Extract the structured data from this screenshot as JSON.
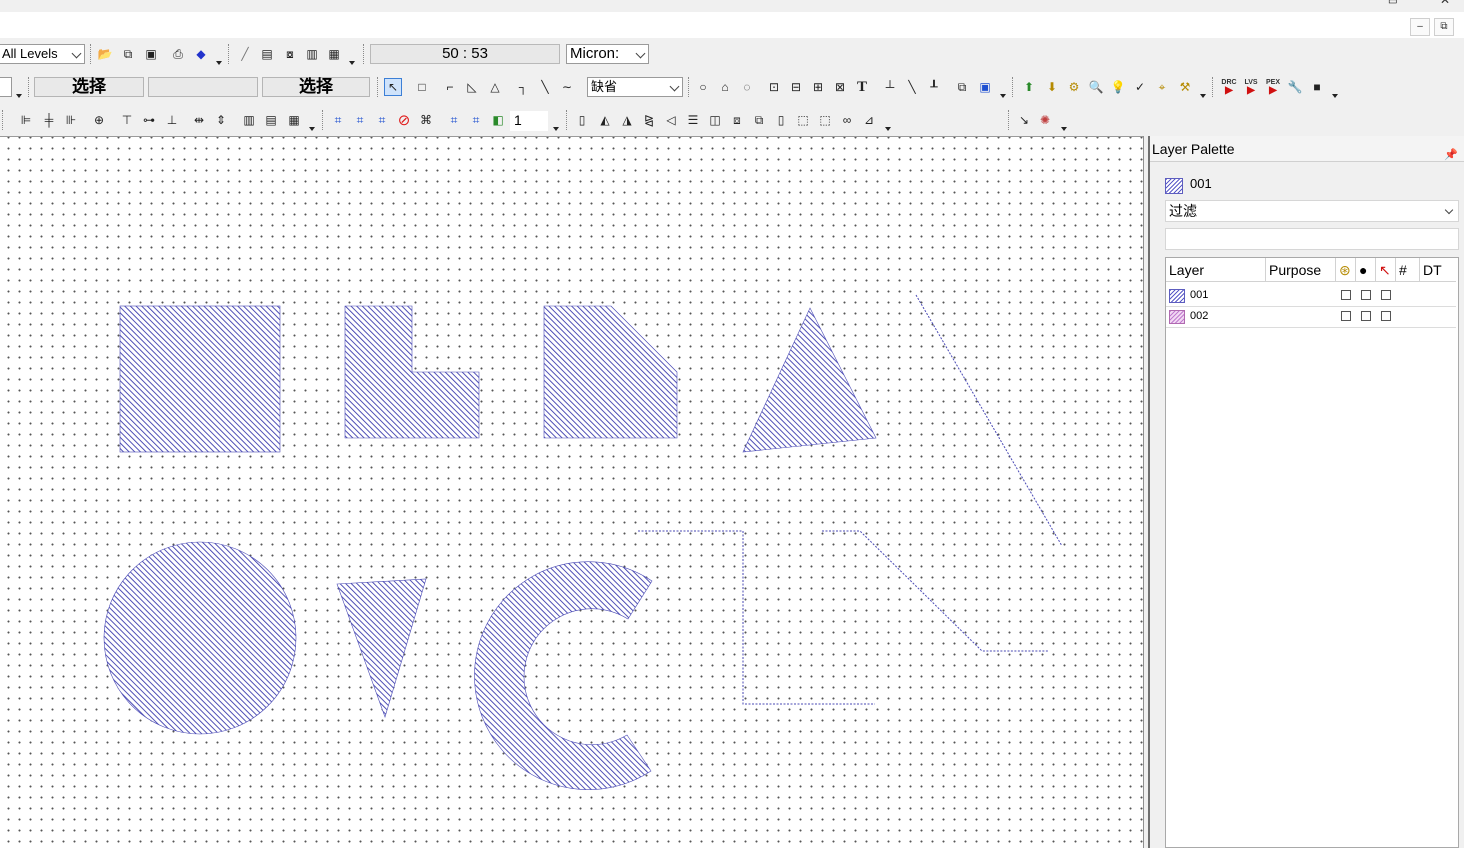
{
  "colors": {
    "shape_hatch": "#3c3cae",
    "layer_002": "#c07ad0",
    "toolbar_bg": "#f0f0f0"
  },
  "toolbar": {
    "levels_select": "All Levels",
    "coordinates": "50 : 53",
    "units_select": "Micron:",
    "mode_label_1": "选择",
    "mode_label_2": "",
    "mode_label_3": "选择",
    "default_select": "缺省",
    "snap_value": "1",
    "text_tool": "T",
    "drc_label": "DRC",
    "lvs_label": "LVS",
    "pex_label": "PEX"
  },
  "palette": {
    "title": "Layer Palette",
    "current_layer": "001",
    "filter_select": "过滤",
    "filter_text": "",
    "columns": {
      "layer": "Layer",
      "purpose": "Purpose",
      "hash": "#",
      "dt": "DT"
    },
    "layers": [
      {
        "name": "001",
        "purpose": ""
      },
      {
        "name": "002",
        "purpose": ""
      }
    ]
  }
}
